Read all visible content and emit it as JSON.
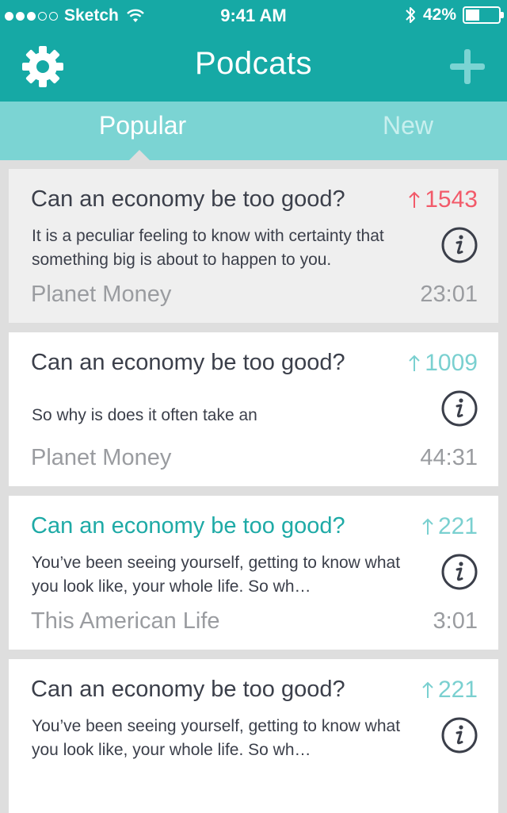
{
  "status_bar": {
    "carrier": "Sketch",
    "time": "9:41 AM",
    "battery": "42%",
    "battery_level": 0.42,
    "signal_bars": 3,
    "signal_total": 5
  },
  "header": {
    "title": "Podcats",
    "settings_icon": "gear-icon",
    "add_icon": "plus-icon"
  },
  "tabs": [
    {
      "label": "Popular",
      "active": true
    },
    {
      "label": "New",
      "active": false
    }
  ],
  "colors": {
    "header": "#16a9a5",
    "tabs": "#7bd4d3",
    "accent": "#1eaaa6",
    "hot": "#f25a6a",
    "upvote": "#7ad0d0"
  },
  "episodes": [
    {
      "title": "Can an economy be too good?",
      "votes": "1543",
      "description": "It is a peculiar feeling to know with certainty that something big is about to happen to you.",
      "source": "Planet Money",
      "duration": "23:01"
    },
    {
      "title": "Can an economy be too good?",
      "votes": "1009",
      "description": "So why is does it often take an",
      "source": "Planet Money",
      "duration": "44:31"
    },
    {
      "title": "Can an economy be too good?",
      "votes": "221",
      "description": "You’ve been seeing yourself, getting to know what you look like, your whole life. So wh…",
      "source": "This American Life",
      "duration": "3:01"
    },
    {
      "title": "Can an economy be too good?",
      "votes": "221",
      "description": "You’ve been seeing yourself, getting to know what you look like, your whole life. So wh…",
      "source": "",
      "duration": ""
    }
  ]
}
